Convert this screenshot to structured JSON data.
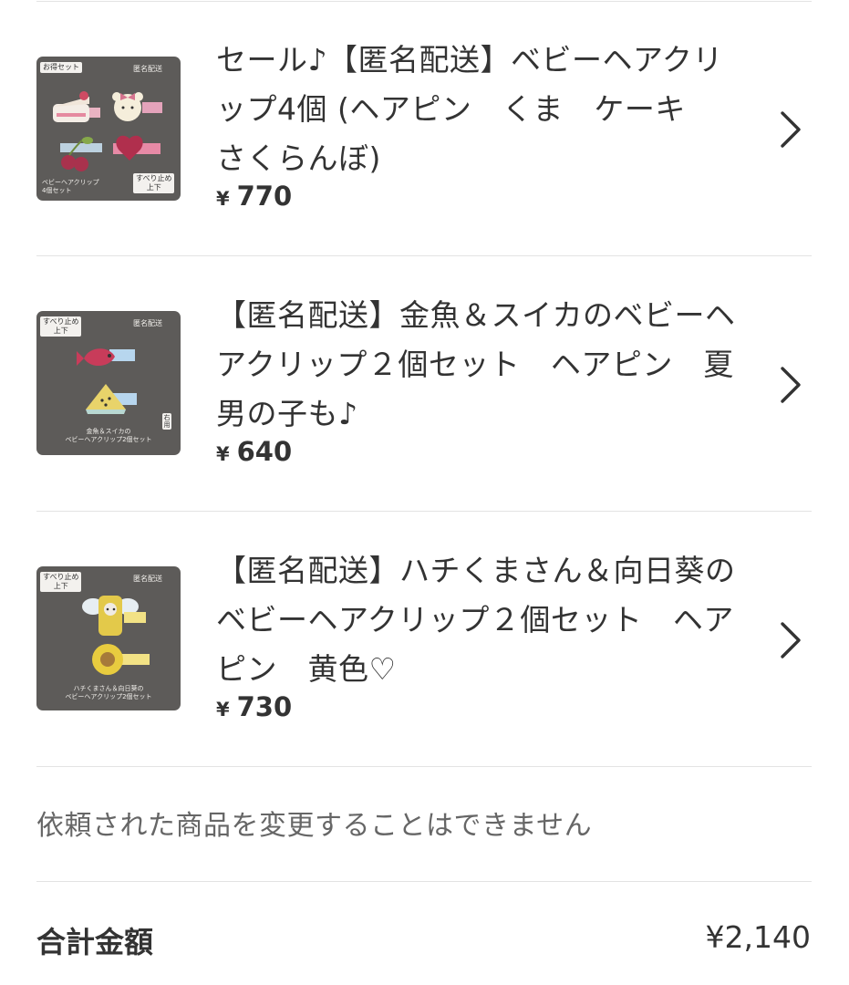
{
  "items": [
    {
      "title": "セール♪【匿名配送】ベビーヘアクリップ4個 (ヘアピン　くま　ケーキ　さくらんぼ)",
      "yen": "¥",
      "price": "770",
      "thumb": {
        "tag_left": "お得セット",
        "tag_right": "匿名配送",
        "caption_left": "ベビーヘアクリップ\n4個セット",
        "caption_right": "すべり止め\n上下"
      }
    },
    {
      "title": "【匿名配送】金魚＆スイカのベビーヘアクリップ２個セット　ヘアピン　夏　男の子も♪",
      "yen": "¥",
      "price": "640",
      "thumb": {
        "tag_left": "すべり止め\n上下",
        "tag_right": "匿名配送",
        "caption": "金魚＆スイカの\nベビーヘアクリップ2個セット",
        "side_tag": "右用"
      }
    },
    {
      "title": "【匿名配送】ハチくまさん＆向日葵のベビーヘアクリップ２個セット　ヘアピン　黄色♡",
      "yen": "¥",
      "price": "730",
      "thumb": {
        "tag_left": "すべり止め\n上下",
        "tag_right": "匿名配送",
        "caption": "ハチくまさん＆向日葵の\nベビーヘアクリップ2個セット"
      }
    }
  ],
  "notice": "依頼された商品を変更することはできません",
  "total": {
    "label": "合計金額",
    "value": "¥2,140"
  },
  "colors": {
    "text": "#333333",
    "muted": "#666666",
    "divider": "#e3e3e3",
    "thumb_bg": "#5d5b59"
  }
}
